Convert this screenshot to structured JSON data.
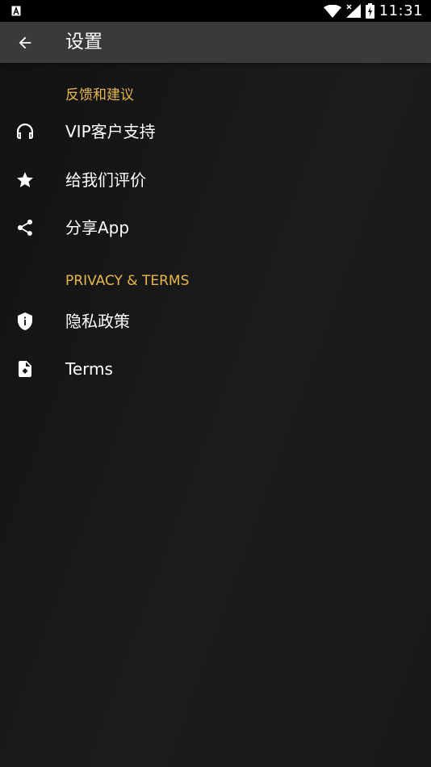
{
  "status_bar": {
    "time": "11:31",
    "left_icon": "text-a-icon",
    "icons": [
      "wifi-icon",
      "signal-no-data-icon",
      "battery-charging-icon"
    ]
  },
  "app_bar": {
    "back_icon": "arrow-back-icon",
    "title": "设置"
  },
  "sections": [
    {
      "header": "反馈和建议",
      "items": [
        {
          "label": "VIP客户支持",
          "icon": "headset-icon"
        },
        {
          "label": "给我们评价",
          "icon": "star-icon"
        },
        {
          "label": "分享App",
          "icon": "share-icon"
        }
      ]
    },
    {
      "header": "PRIVACY & TERMS",
      "items": [
        {
          "label": "隐私政策",
          "icon": "shield-info-icon"
        },
        {
          "label": "Terms",
          "icon": "document-icon"
        }
      ]
    }
  ],
  "colors": {
    "accent": "#e8b84a",
    "app_bar": "#3a3a3a",
    "background": "#1a1a1a",
    "text": "#ffffff"
  }
}
